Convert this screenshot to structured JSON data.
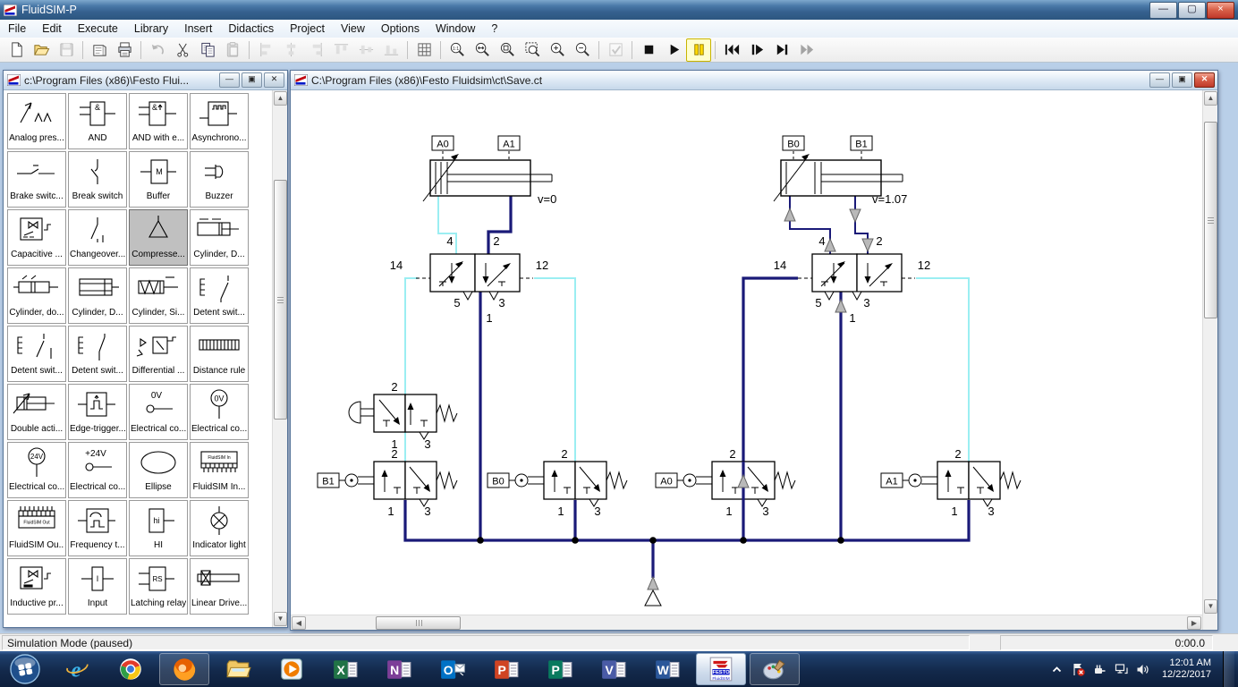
{
  "app": {
    "title": "FluidSIM-P"
  },
  "menu": {
    "items": [
      "File",
      "Edit",
      "Execute",
      "Library",
      "Insert",
      "Didactics",
      "Project",
      "View",
      "Options",
      "Window",
      "?"
    ]
  },
  "toolbar": {
    "groups": [
      {
        "items": [
          {
            "name": "new-file",
            "state": "normal"
          },
          {
            "name": "open-file",
            "state": "normal"
          },
          {
            "name": "save-file",
            "state": "disabled"
          }
        ]
      },
      {
        "items": [
          {
            "name": "page-setup",
            "state": "normal"
          },
          {
            "name": "print",
            "state": "normal"
          }
        ]
      },
      {
        "items": [
          {
            "name": "undo",
            "state": "disabled"
          },
          {
            "name": "cut",
            "state": "normal"
          },
          {
            "name": "copy",
            "state": "normal"
          },
          {
            "name": "paste",
            "state": "disabled"
          }
        ]
      },
      {
        "items": [
          {
            "name": "align-left",
            "state": "disabled"
          },
          {
            "name": "align-center-horizontal",
            "state": "disabled"
          },
          {
            "name": "align-right",
            "state": "disabled"
          },
          {
            "name": "align-top",
            "state": "disabled"
          },
          {
            "name": "align-middle-vertical",
            "state": "disabled"
          },
          {
            "name": "align-bottom",
            "state": "disabled"
          }
        ]
      },
      {
        "items": [
          {
            "name": "grid",
            "state": "normal"
          }
        ]
      },
      {
        "items": [
          {
            "name": "zoom-original",
            "state": "normal"
          },
          {
            "name": "zoom-fit-width",
            "state": "normal"
          },
          {
            "name": "zoom-fit-page",
            "state": "normal"
          },
          {
            "name": "zoom-rectangle",
            "state": "normal"
          },
          {
            "name": "zoom-in",
            "state": "normal"
          },
          {
            "name": "zoom-out",
            "state": "normal"
          }
        ]
      },
      {
        "items": [
          {
            "name": "check-circuit",
            "state": "disabled"
          }
        ]
      },
      {
        "items": [
          {
            "name": "stop-simulation",
            "state": "normal"
          },
          {
            "name": "start-simulation",
            "state": "normal"
          },
          {
            "name": "pause-simulation",
            "state": "active"
          }
        ]
      },
      {
        "items": [
          {
            "name": "reset-simulation",
            "state": "normal"
          },
          {
            "name": "single-step",
            "state": "normal"
          },
          {
            "name": "simulate-to-state-change",
            "state": "normal"
          },
          {
            "name": "fast-forward",
            "state": "disabled"
          }
        ]
      }
    ]
  },
  "library_window": {
    "title": "c:\\Program Files (x86)\\Festo Flui...",
    "items": [
      {
        "label": "Analog pres...",
        "icon": "analog-pressure"
      },
      {
        "label": "AND",
        "icon": "and-gate"
      },
      {
        "label": "AND with e...",
        "icon": "and-edge"
      },
      {
        "label": "Asynchrono...",
        "icon": "async-counter"
      },
      {
        "label": "Brake switc...",
        "icon": "brake-switch"
      },
      {
        "label": "Break switch",
        "icon": "break-switch"
      },
      {
        "label": "Buffer",
        "icon": "buffer"
      },
      {
        "label": "Buzzer",
        "icon": "buzzer"
      },
      {
        "label": "Capacitive ...",
        "icon": "capacitive-sensor"
      },
      {
        "label": "Changeover...",
        "icon": "changeover-switch"
      },
      {
        "label": "Compresse...",
        "icon": "compressed-air",
        "selected": true
      },
      {
        "label": "Cylinder, D...",
        "icon": "cylinder-double"
      },
      {
        "label": "Cylinder, do...",
        "icon": "cylinder-double-rod"
      },
      {
        "label": "Cylinder, D...",
        "icon": "cylinder-double2"
      },
      {
        "label": "Cylinder, Si...",
        "icon": "cylinder-single"
      },
      {
        "label": "Detent swit...",
        "icon": "detent-switch"
      },
      {
        "label": "Detent swit...",
        "icon": "detent-switch2"
      },
      {
        "label": "Detent swit...",
        "icon": "detent-switch3"
      },
      {
        "label": "Differential ...",
        "icon": "differential"
      },
      {
        "label": "Distance rule",
        "icon": "distance-rule"
      },
      {
        "label": "Double acti...",
        "icon": "double-acting"
      },
      {
        "label": "Edge-trigger...",
        "icon": "edge-trigger"
      },
      {
        "label": "Electrical co...",
        "icon": "elec-0v"
      },
      {
        "label": "Electrical co...",
        "icon": "elec-0v-circle"
      },
      {
        "label": "Electrical co...",
        "icon": "elec-24v-circle"
      },
      {
        "label": "Electrical co...",
        "icon": "elec-24v"
      },
      {
        "label": "Ellipse",
        "icon": "ellipse"
      },
      {
        "label": "FluidSIM In...",
        "icon": "fluidsim-in"
      },
      {
        "label": "FluidSIM Ou...",
        "icon": "fluidsim-out"
      },
      {
        "label": "Frequency t...",
        "icon": "frequency"
      },
      {
        "label": "HI",
        "icon": "hi-label"
      },
      {
        "label": "Indicator light",
        "icon": "indicator-light"
      },
      {
        "label": "Inductive pr...",
        "icon": "inductive-sensor"
      },
      {
        "label": "Input",
        "icon": "input"
      },
      {
        "label": "Latching relay",
        "icon": "latching-relay"
      },
      {
        "label": "Linear Drive...",
        "icon": "linear-drive"
      }
    ]
  },
  "canvas_window": {
    "title": "C:\\Program Files (x86)\\Festo Fluidsim\\ct\\Save.ct"
  },
  "circuit": {
    "tags": {
      "a0": "A0",
      "a1": "A1",
      "b0": "B0",
      "b1": "B1"
    },
    "velocity_a": "v=0",
    "velocity_b": "v=1.07",
    "valve52_ports": {
      "p14": "14",
      "p12": "12",
      "p4": "4",
      "p2": "2",
      "p5": "5",
      "p3": "3",
      "p1": "1"
    },
    "valve32_ports": {
      "p2": "2",
      "p1": "1",
      "p3": "3"
    },
    "wire_colors": {
      "pressurized": "#1a1a78",
      "exhaust": "#9beef2"
    }
  },
  "statusbar": {
    "mode": "Simulation Mode (paused)",
    "sim_time": "0:00.0"
  },
  "taskbar": {
    "items": [
      {
        "name": "start"
      },
      {
        "name": "internet-explorer"
      },
      {
        "name": "chrome"
      },
      {
        "name": "firefox",
        "open": true
      },
      {
        "name": "windows-explorer"
      },
      {
        "name": "media-player"
      },
      {
        "name": "excel"
      },
      {
        "name": "onenote"
      },
      {
        "name": "outlook"
      },
      {
        "name": "powerpoint"
      },
      {
        "name": "publisher"
      },
      {
        "name": "visio"
      },
      {
        "name": "word"
      },
      {
        "name": "fluidsim",
        "active": true
      },
      {
        "name": "paint",
        "open": true
      }
    ],
    "tray": {
      "time": "12:01 AM",
      "date": "12/22/2017"
    }
  }
}
